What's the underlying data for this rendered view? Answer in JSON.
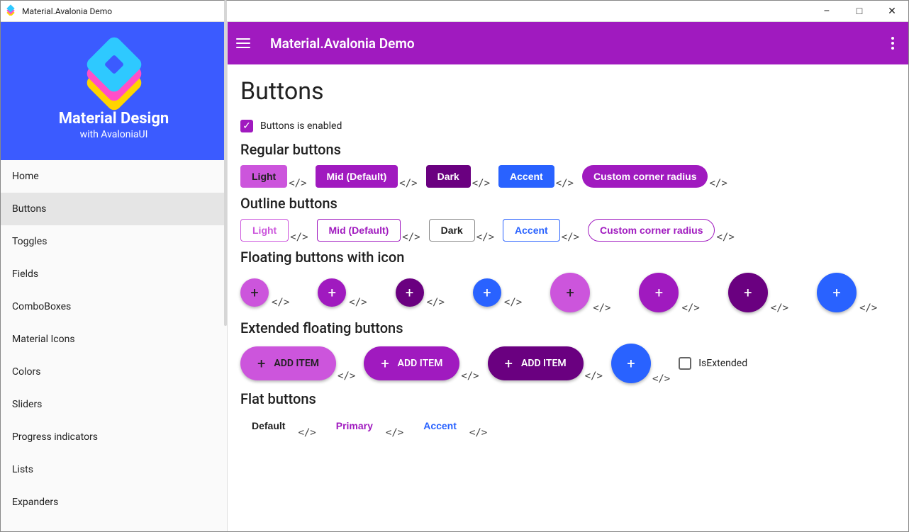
{
  "window_title": "Material.Avalonia Demo",
  "sidebar": {
    "title": "Material Design",
    "subtitle": "with AvaloniaUI",
    "items": [
      {
        "label": "Home",
        "active": false
      },
      {
        "label": "Buttons",
        "active": true
      },
      {
        "label": "Toggles",
        "active": false
      },
      {
        "label": "Fields",
        "active": false
      },
      {
        "label": "ComboBoxes",
        "active": false
      },
      {
        "label": "Material Icons",
        "active": false
      },
      {
        "label": "Colors",
        "active": false
      },
      {
        "label": "Sliders",
        "active": false
      },
      {
        "label": "Progress indicators",
        "active": false
      },
      {
        "label": "Lists",
        "active": false
      },
      {
        "label": "Expanders",
        "active": false
      }
    ]
  },
  "appbar": {
    "title": "Material.Avalonia Demo"
  },
  "page": {
    "title": "Buttons",
    "enable_checkbox": "Buttons is enabled",
    "is_extended_label": "IsExtended",
    "sections": {
      "regular": "Regular buttons",
      "outline": "Outline buttons",
      "floating": "Floating buttons with icon",
      "extended": "Extended floating buttons",
      "flat": "Flat buttons"
    },
    "btn_labels": {
      "light": "Light",
      "mid": "Mid (Default)",
      "dark": "Dark",
      "accent": "Accent",
      "custom": "Custom corner radius",
      "add_item": "ADD ITEM",
      "default": "Default",
      "primary": "Primary"
    }
  },
  "colors": {
    "primary": "#a01abf",
    "primary_light": "#cc55dc",
    "primary_dark": "#6a0080",
    "accent": "#2962ff",
    "sidebar_header": "#3b5bff"
  }
}
